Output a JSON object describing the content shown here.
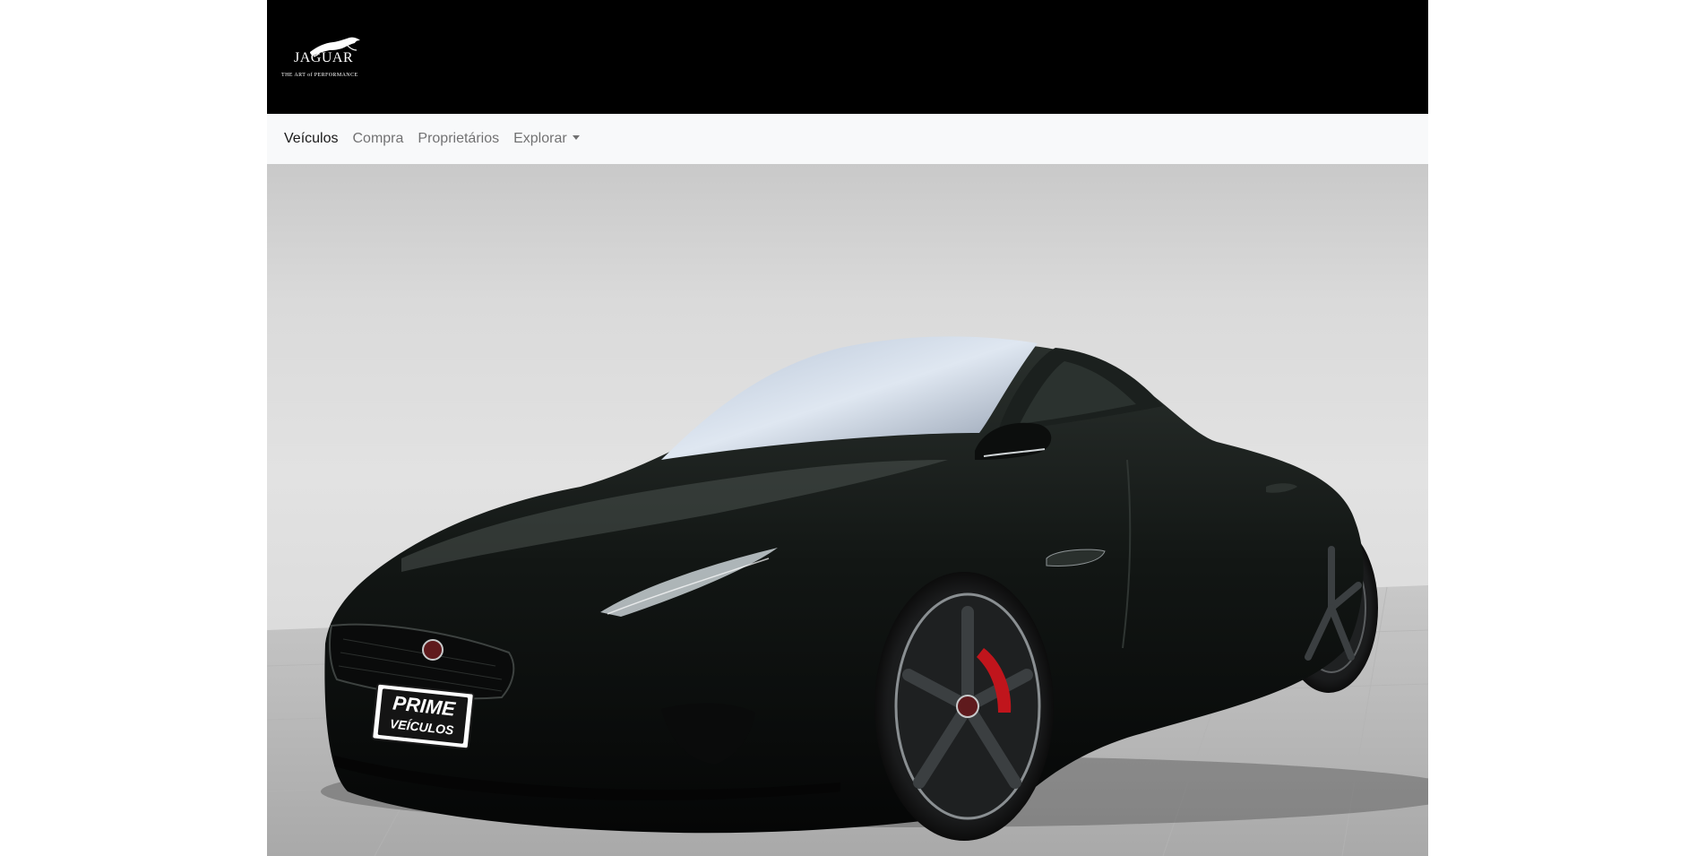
{
  "brand": {
    "logo_word": "JAGUAR",
    "logo_tagline": "THE ART of PERFORMANCE",
    "logo_icon": "jaguar-leaper-icon"
  },
  "nav": {
    "items": [
      {
        "label": "Veículos",
        "active": true
      },
      {
        "label": "Compra",
        "active": false
      },
      {
        "label": "Proprietários",
        "active": false
      },
      {
        "label": "Explorar",
        "active": false,
        "dropdown": true
      }
    ]
  },
  "hero": {
    "alt": "Jaguar F-TYPE coupé",
    "plate_line1": "PRIME",
    "plate_line2": "VEÍCULOS"
  },
  "colors": {
    "header_bg": "#000000",
    "navbar_bg": "#f8f9fa",
    "car_body": "#101412",
    "brake_caliper": "#c0151c"
  }
}
